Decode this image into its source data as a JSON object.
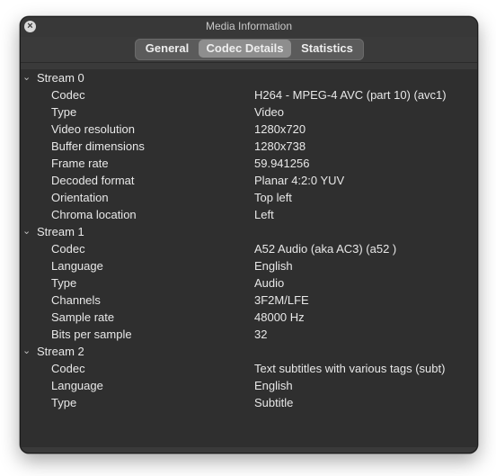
{
  "window": {
    "title": "Media Information",
    "close_symbol": "×"
  },
  "tabs": [
    {
      "label": "General",
      "selected": false
    },
    {
      "label": "Codec Details",
      "selected": true
    },
    {
      "label": "Statistics",
      "selected": false
    }
  ],
  "streams": [
    {
      "label": "Stream 0",
      "rows": [
        {
          "key": "Codec",
          "value": "H264 - MPEG-4 AVC (part 10) (avc1)"
        },
        {
          "key": "Type",
          "value": "Video"
        },
        {
          "key": "Video resolution",
          "value": "1280x720"
        },
        {
          "key": "Buffer dimensions",
          "value": "1280x738"
        },
        {
          "key": "Frame rate",
          "value": "59.941256"
        },
        {
          "key": "Decoded format",
          "value": "Planar 4:2:0 YUV"
        },
        {
          "key": "Orientation",
          "value": "Top left"
        },
        {
          "key": "Chroma location",
          "value": "Left"
        }
      ]
    },
    {
      "label": "Stream 1",
      "rows": [
        {
          "key": "Codec",
          "value": "A52 Audio (aka AC3) (a52 )"
        },
        {
          "key": "Language",
          "value": "English"
        },
        {
          "key": "Type",
          "value": "Audio"
        },
        {
          "key": "Channels",
          "value": "3F2M/LFE"
        },
        {
          "key": "Sample rate",
          "value": "48000 Hz"
        },
        {
          "key": "Bits per sample",
          "value": "32"
        }
      ]
    },
    {
      "label": "Stream 2",
      "rows": [
        {
          "key": "Codec",
          "value": "Text subtitles with various tags (subt)"
        },
        {
          "key": "Language",
          "value": "English"
        },
        {
          "key": "Type",
          "value": "Subtitle"
        }
      ]
    }
  ],
  "chevron": "⌄"
}
